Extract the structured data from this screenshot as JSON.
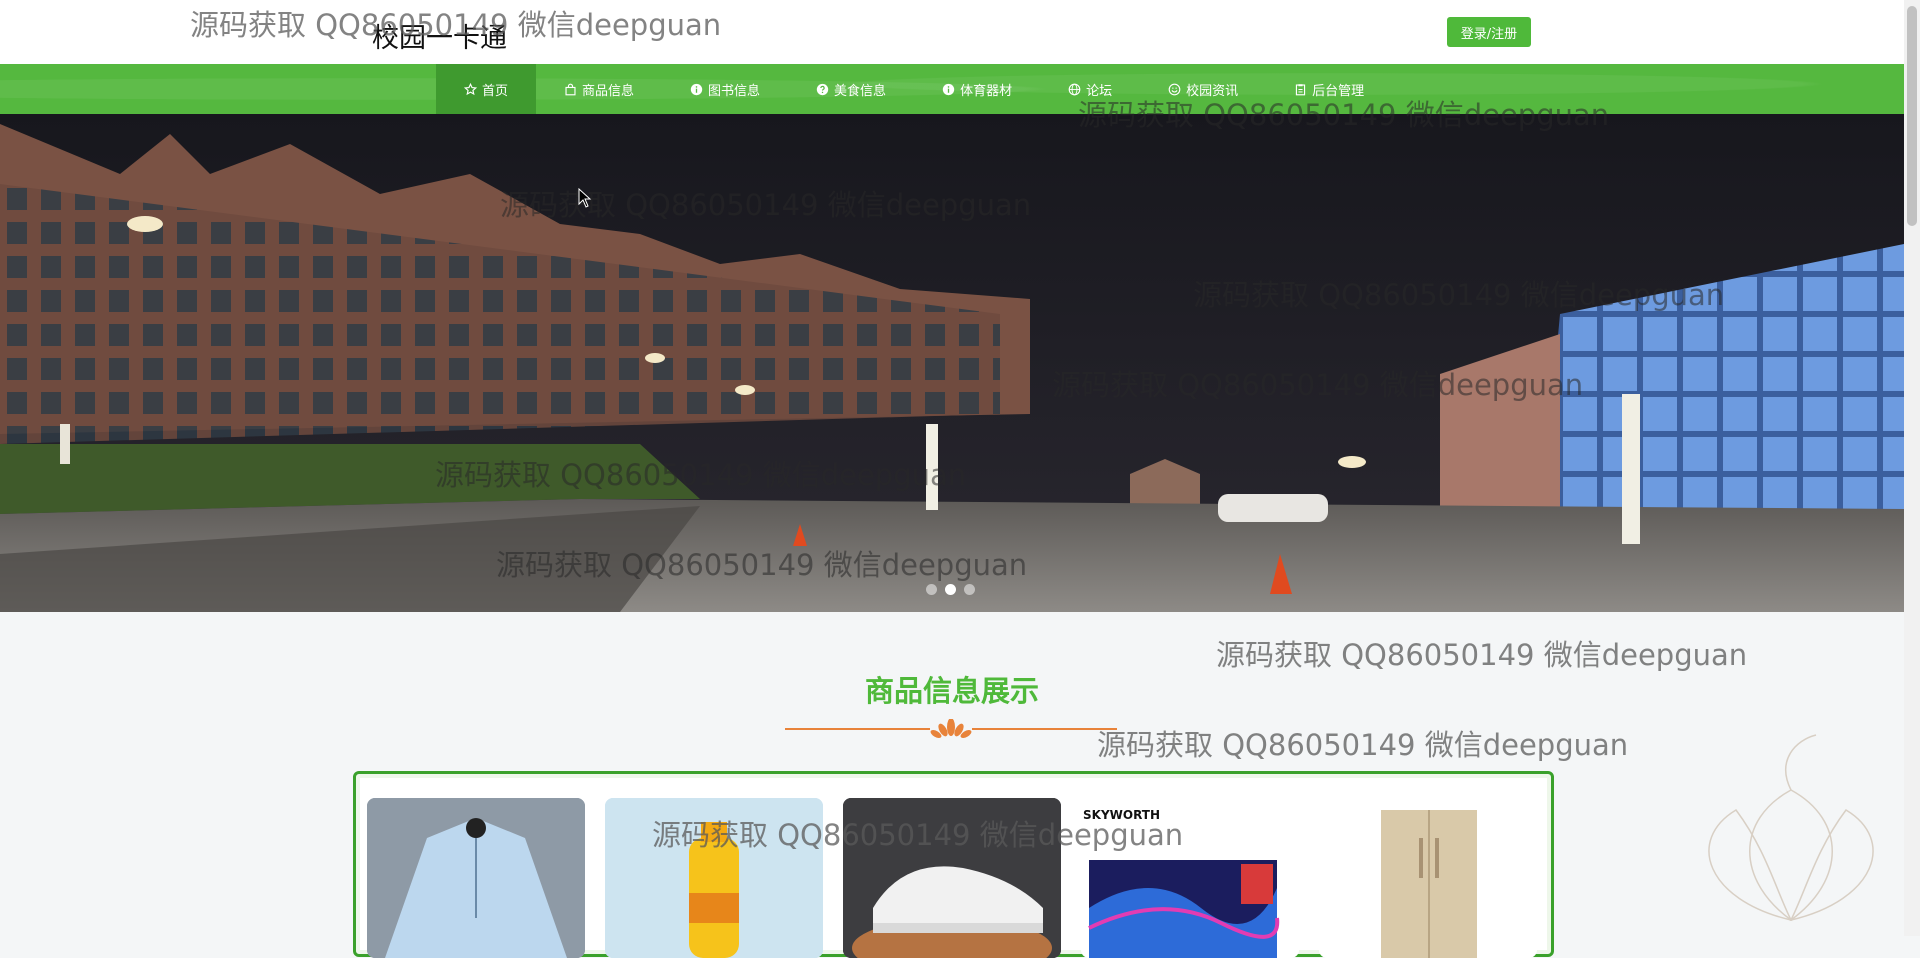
{
  "header": {
    "site_title": "校园一卡通",
    "login_label": "登录/注册"
  },
  "nav": {
    "items": [
      {
        "label": "首页",
        "icon": "star-icon",
        "active": true
      },
      {
        "label": "商品信息",
        "icon": "bag-icon"
      },
      {
        "label": "图书信息",
        "icon": "info-circle-icon"
      },
      {
        "label": "美食信息",
        "icon": "question-circle-icon"
      },
      {
        "label": "体育器材",
        "icon": "info-circle-icon"
      },
      {
        "label": "论坛",
        "icon": "globe-icon"
      },
      {
        "label": "校园资讯",
        "icon": "smile-circle-icon"
      },
      {
        "label": "后台管理",
        "icon": "clipboard-icon"
      }
    ]
  },
  "banner": {
    "slide_count": 3,
    "active_slide": 2
  },
  "section": {
    "title": "商品信息展示"
  },
  "products": [
    {
      "name": "light blue shirt"
    },
    {
      "name": "orange juice bottle"
    },
    {
      "name": "white sneaker"
    },
    {
      "name": "skyworth tv",
      "brand_text": "SKYWORTH"
    },
    {
      "name": "refrigerator"
    }
  ],
  "watermark_text": "源码获取 QQ86050149 微信deepguan",
  "colors": {
    "brand_green": "#55b83f",
    "nav_active": "#3f9a2f",
    "title_green": "#4fb93a",
    "accent_orange": "#e8833a"
  }
}
